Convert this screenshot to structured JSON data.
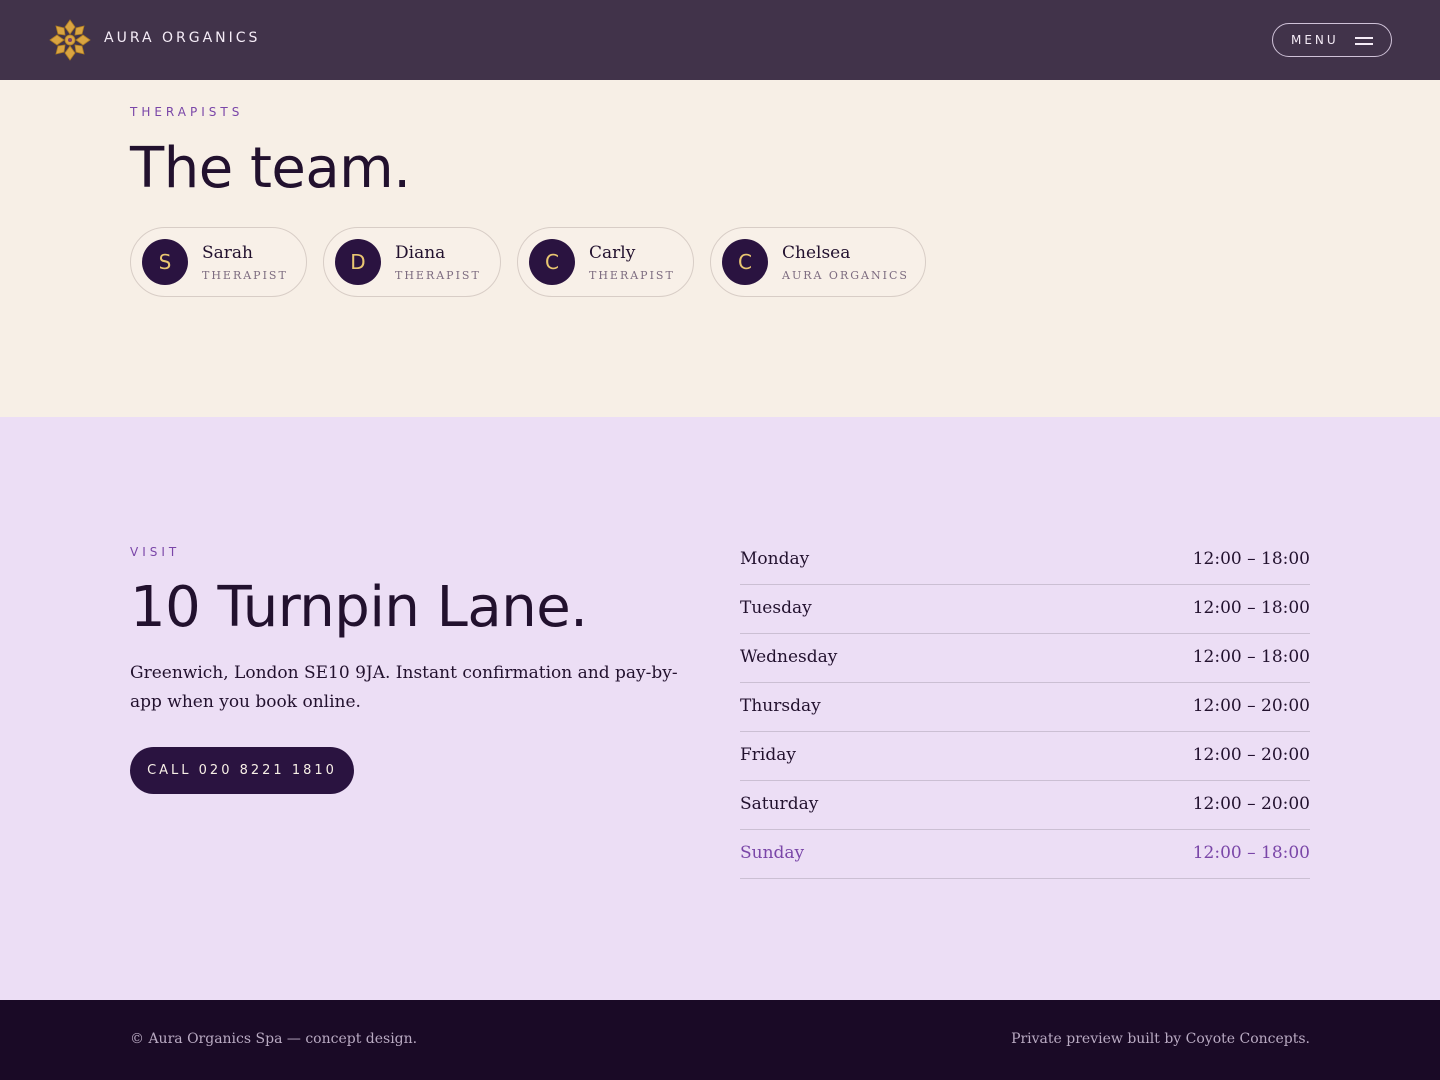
{
  "header": {
    "brand": "AURA ORGANICS",
    "logo_icon": "lotus-mandala-icon",
    "menu_label": "MENU",
    "menu_icon": "hamburger-icon"
  },
  "team": {
    "eyebrow": "THERAPISTS",
    "title": "The team.",
    "members": [
      {
        "initial": "S",
        "name": "Sarah",
        "role": "THERAPIST"
      },
      {
        "initial": "D",
        "name": "Diana",
        "role": "THERAPIST"
      },
      {
        "initial": "C",
        "name": "Carly",
        "role": "THERAPIST"
      },
      {
        "initial": "C",
        "name": "Chelsea",
        "role": "AURA ORGANICS"
      }
    ]
  },
  "visit": {
    "eyebrow": "VISIT",
    "title": "10 Turnpin Lane.",
    "description": "Greenwich, London SE10 9JA. Instant confirmation and pay-by-app when you book online.",
    "call_label": "CALL 020 8221 1810",
    "hours": [
      {
        "day": "Monday",
        "time": "12:00 – 18:00"
      },
      {
        "day": "Tuesday",
        "time": "12:00 – 18:00"
      },
      {
        "day": "Wednesday",
        "time": "12:00 – 18:00"
      },
      {
        "day": "Thursday",
        "time": "12:00 – 20:00"
      },
      {
        "day": "Friday",
        "time": "12:00 – 20:00"
      },
      {
        "day": "Saturday",
        "time": "12:00 – 20:00"
      },
      {
        "day": "Sunday",
        "time": "12:00 – 18:00",
        "highlight": true
      }
    ]
  },
  "footer": {
    "left": "© Aura Organics Spa — concept design.",
    "right": "Private preview built by Coyote Concepts."
  },
  "colors": {
    "header_bg": "#41334a",
    "cream_bg": "#f7efe6",
    "lavender_bg": "#ecdef5",
    "accent_purple": "#7a46a8",
    "dark_plum": "#2a1340",
    "gold": "#e9c671",
    "footer_bg": "#1a0a26"
  }
}
